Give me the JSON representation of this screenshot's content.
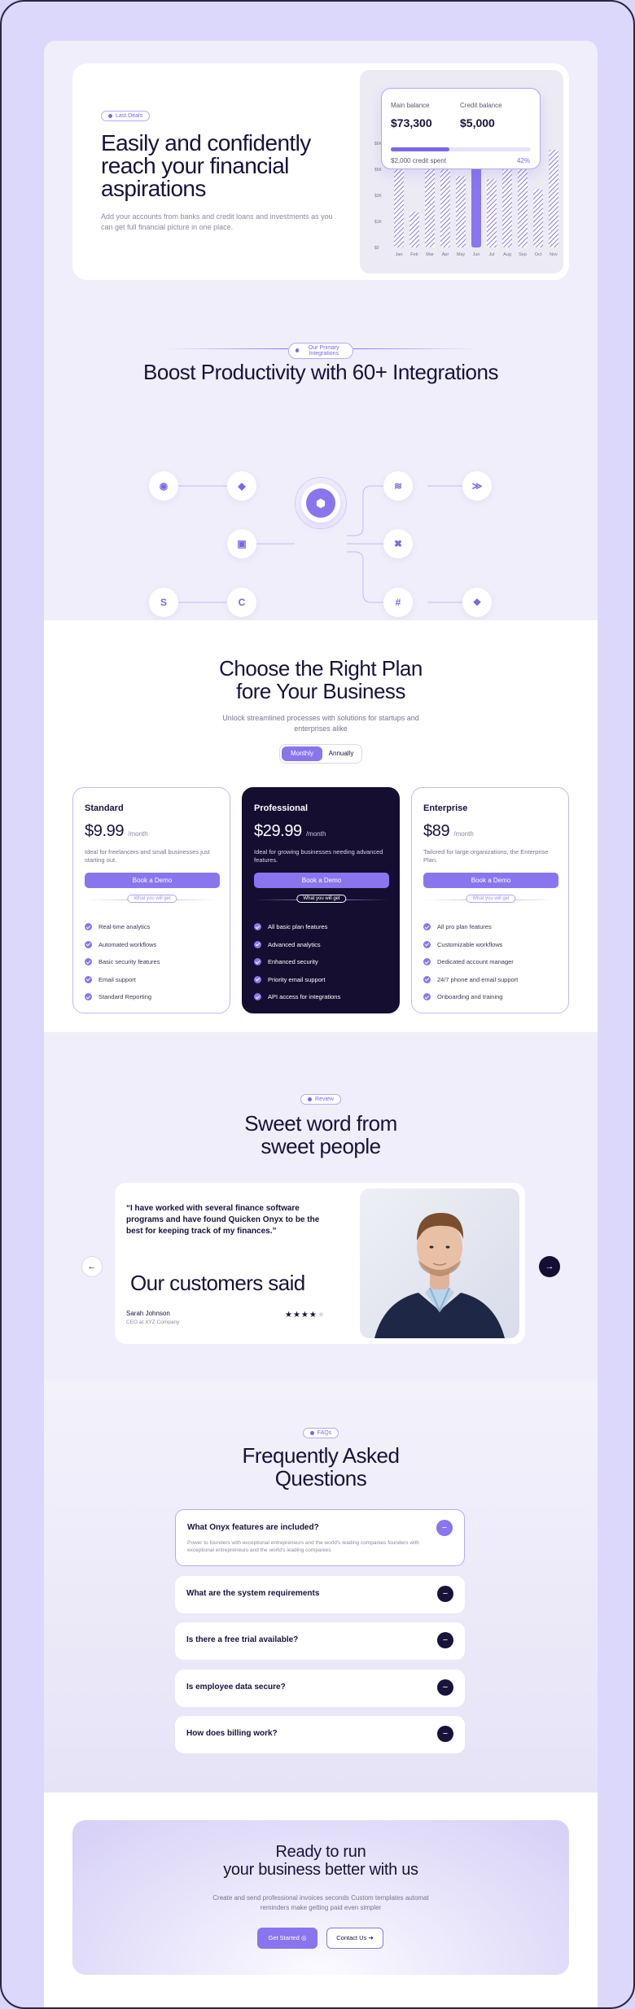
{
  "hero": {
    "badge": "Last Deals",
    "title": "Easily and confidently reach your financial aspirations",
    "subtitle": "Add your accounts from banks and credit loans and investments as you can get  full financial picture in one place.",
    "main_balance_label": "Main balance",
    "main_balance_value": "$73,300",
    "credit_balance_label": "Credit balance",
    "credit_balance_value": "$5,000",
    "credit_spent": "$2,000 credit spent",
    "credit_pct_label": "42%",
    "credit_pct": 0.42
  },
  "chart_data": {
    "type": "bar",
    "categories": [
      "Jan",
      "Feb",
      "Mar",
      "Apr",
      "May",
      "Jun",
      "Jul",
      "Aug",
      "Sep",
      "Oct",
      "Nov"
    ],
    "values": [
      140,
      55,
      135,
      140,
      110,
      140,
      105,
      140,
      125,
      90,
      150
    ],
    "highlight_index": 5,
    "ytick_labels": [
      "$6K",
      "$5K",
      "$3K",
      "$1K",
      "$0"
    ],
    "ylim": [
      0,
      160
    ]
  },
  "integrations": {
    "tag": "Our Primary Integrations",
    "title": "Boost Productivity with 60+ Integrations",
    "icons": [
      "discord-icon",
      "dropbox-icon",
      "wave-icon",
      "layers-icon",
      "square-icon",
      "xbox-icon",
      "skype-icon",
      "c-logo-icon",
      "slack-icon",
      "diamond-icon"
    ]
  },
  "pricing": {
    "title_line1": "Choose the Right Plan",
    "title_line2": "fore Your Business",
    "subtitle_line1": "Unlock streamlined processes with solutions for startups and",
    "subtitle_line2": "enterprises alike",
    "toggle_monthly": "Monthly",
    "toggle_annually": "Annually",
    "plans": [
      {
        "name": "Standard",
        "price": "$9.99",
        "per": "/month",
        "desc": "Ideal for freelancers and small businesses just starting out.",
        "cta": "Book a Demo",
        "sep": "What you will get",
        "features": [
          "Real-time analytics",
          "Automated workflows",
          "Basic security features",
          "Email support",
          "Standard Reporting"
        ]
      },
      {
        "name": "Professional",
        "price": "$29.99",
        "per": "/month",
        "desc": "Ideal for growing businesses needing advanced features.",
        "cta": "Book a Demo",
        "sep": "What you will get",
        "features": [
          "All basic plan features",
          "Advanced analytics",
          "Enhanced security",
          "Priority email support",
          "API access for integrations"
        ]
      },
      {
        "name": "Enterprise",
        "price": "$89",
        "per": "/month",
        "desc": "Tailored for large organizations, the Enterprise Plan.",
        "cta": "Book a Demo",
        "sep": "What you will get",
        "features": [
          "All pro plan features",
          "Customizable workflows",
          "Dedicated account manager",
          "24/7 phone and email support",
          "Onboarding and training"
        ]
      }
    ]
  },
  "testimonials": {
    "tag": "Review",
    "title_line1": "Sweet word from",
    "title_line2": "sweet people",
    "quote": "“I have worked with several finance software programs and have found Quicken Onyx to be the best for keeping track of my finances.”",
    "heading": "Our customers said",
    "author": "Sarah Johnson",
    "role": "CEO at XYZ Company",
    "stars": "★★★★",
    "star_empty": "★",
    "rating": 4,
    "prev_icon": "←",
    "next_icon": "→"
  },
  "faq": {
    "tag": "FAQs",
    "title_line1": "Frequently Asked",
    "title_line2": "Questions",
    "items": [
      {
        "q": "What Onyx features are included?",
        "a": "Power to founders with exceptional entrepreneurs and the world's leading companies founders with exceptional entrepreneurs and the world's leading companies",
        "icon": "−"
      },
      {
        "q": "What are the system requirements",
        "icon": "−"
      },
      {
        "q": "Is there a free trial available?",
        "icon": "−"
      },
      {
        "q": "Is employee data secure?",
        "icon": "−"
      },
      {
        "q": "How does billing work?",
        "icon": "−"
      }
    ]
  },
  "cta": {
    "title_line1": "Ready to run",
    "title_line2": "your business better with us",
    "text": "Create and send professional invoices seconds Custom templates automat reminders make getting paid even simpler",
    "primary": "Get Started",
    "secondary": "Contact Us",
    "primary_icon": "◎",
    "secondary_icon": "➔"
  },
  "colors": {
    "accent": "#8a75ee",
    "dark": "#150e31",
    "bg": "#dcd8fc"
  }
}
